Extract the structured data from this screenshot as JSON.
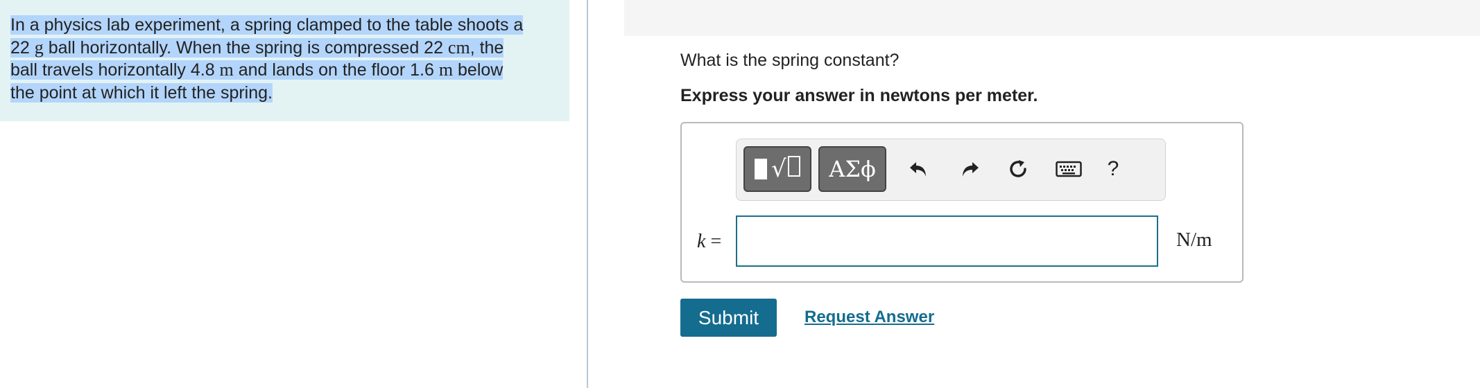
{
  "problem": {
    "part1": "In a physics lab experiment, a spring clamped to the table shoots a",
    "part2a": "22 ",
    "unit_g": "g",
    "part2b": " ball horizontally. When the spring is compressed 22 ",
    "unit_cm": "cm",
    "part2c": ", the",
    "part3a": "ball travels horizontally 4.8 ",
    "unit_m1": "m",
    "part3b": " and lands on the floor 1.6 ",
    "unit_m2": "m",
    "part3c": " below",
    "part4": "the point at which it left the spring."
  },
  "question": "What is the spring constant?",
  "instruction": "Express your answer in newtons per meter.",
  "toolbar": {
    "greek_label": "ΑΣϕ",
    "help_label": "?"
  },
  "answer": {
    "variable": "k",
    "equals": " =",
    "value": "",
    "unit": "N/m"
  },
  "submit_label": "Submit",
  "request_label": "Request Answer",
  "colors": {
    "accent": "#146c8f",
    "panel_bg": "#e3f3f4",
    "highlight": "#b3d5fb"
  }
}
